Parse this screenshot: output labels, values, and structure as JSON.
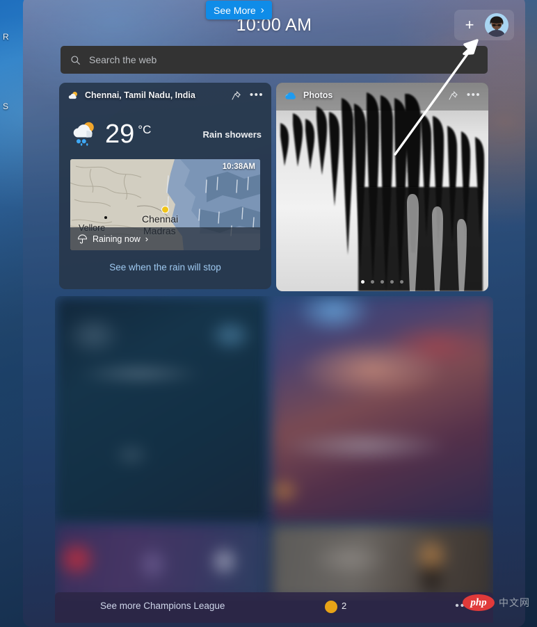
{
  "desktop": {
    "icon_labels": [
      "R",
      "S"
    ]
  },
  "panel": {
    "clock": "10:00 AM",
    "add_widget_label": "+",
    "avatar_name": "user-avatar",
    "scrollbar_name": "panel-scrollbar"
  },
  "search": {
    "placeholder": "Search the web",
    "icon": "search-icon"
  },
  "weather": {
    "location": "Chennai, Tamil Nadu, India",
    "icon": "sun-behind-rain-cloud-icon",
    "temperature": "29",
    "unit": "°C",
    "condition": "Rain showers",
    "map": {
      "time": "10:38AM",
      "labels": [
        "Vellore",
        "Chennai",
        "Madras"
      ],
      "rain_status": "Raining now",
      "rain_chevron": "›",
      "umbrella_icon": "umbrella-icon"
    },
    "link": "See when the rain will stop",
    "pin_icon": "pin-icon",
    "more_icon": "ellipsis-icon"
  },
  "photos": {
    "title": "Photos",
    "app_icon": "onedrive-cloud-icon",
    "pin_icon": "pin-icon",
    "more_icon": "ellipsis-icon",
    "dot_count": 5,
    "active_dot": 1
  },
  "bottom": {
    "league_link": "See more Champions League",
    "see_more_label": "See More",
    "see_more_chevron": "›",
    "badge_count": "2",
    "more_icon": "ellipsis-icon",
    "see_more_color": "#0f8ce8"
  },
  "watermark": {
    "logo_text": "php",
    "cn_text": "中文网",
    "logo_color": "#e03a3a"
  },
  "annotation": {
    "arrow_name": "annotation-arrow-to-add-widget"
  }
}
